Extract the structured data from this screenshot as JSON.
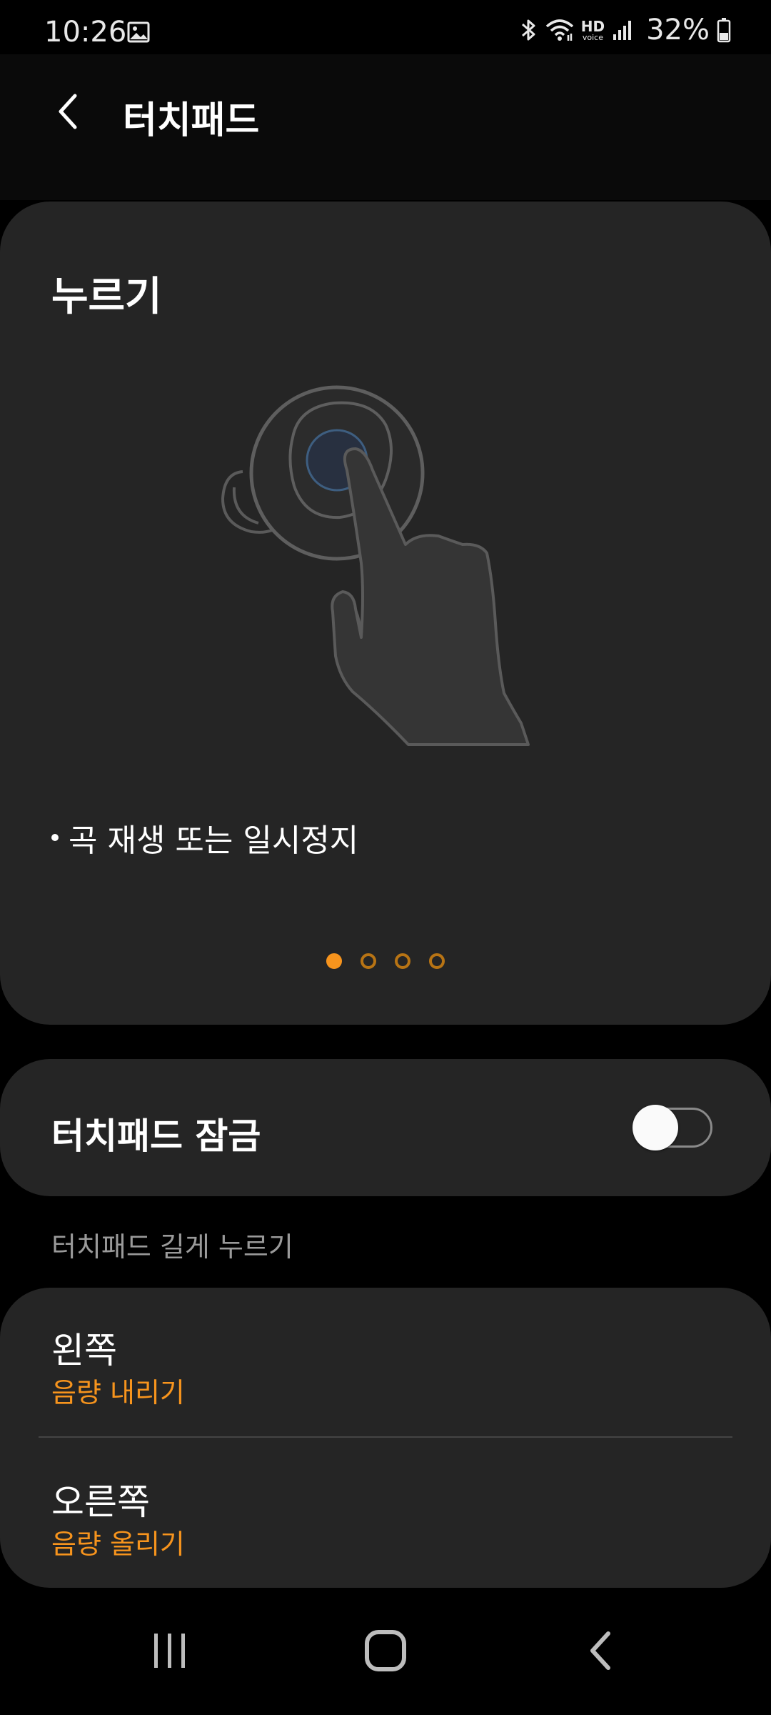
{
  "status_bar": {
    "time": "10:26",
    "battery": "32%",
    "hd_label": "HD",
    "voice_label": "voice",
    "icons": [
      "gallery-icon",
      "bluetooth-icon",
      "wifi-icon",
      "hd-voice-icon",
      "signal-icon",
      "battery-icon"
    ]
  },
  "header": {
    "title": "터치패드",
    "back_icon": "chevron-left-icon"
  },
  "gesture_card": {
    "title": "누르기",
    "description": "곡 재생 또는 일시정지",
    "illustration": "earbud-tap-illustration",
    "pager": {
      "total": 4,
      "active_index": 0
    }
  },
  "lock": {
    "label": "터치패드 잠금",
    "enabled": false
  },
  "long_press": {
    "section_title": "터치패드 길게 누르기",
    "items": [
      {
        "title": "왼쪽",
        "value": "음량 내리기"
      },
      {
        "title": "오른쪽",
        "value": "음량 올리기"
      }
    ]
  },
  "nav_bar": {
    "icons": [
      "recents-icon",
      "home-icon",
      "back-icon"
    ]
  },
  "colors": {
    "background": "#000000",
    "card": "#252525",
    "accent": "#f7941d",
    "secondary_text": "#9a9a9a"
  }
}
